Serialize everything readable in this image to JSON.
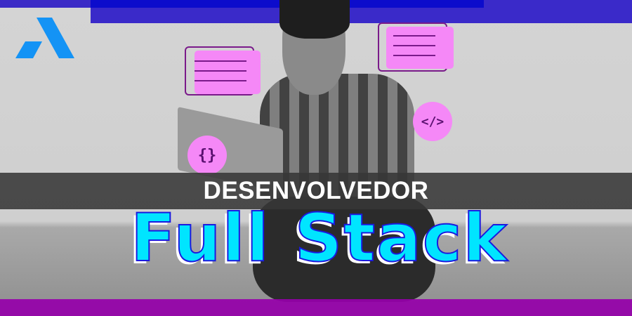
{
  "banner": {
    "subtitle": "DESENVOLVEDOR",
    "title": "Full Stack"
  },
  "decorations": {
    "code_tag_symbol": "</>",
    "braces_symbol": "{}"
  },
  "colors": {
    "logo": "#1493f5",
    "top_bar": "#3a2ac9",
    "title_fill": "#00e5ff",
    "title_stroke": "#1a1adf",
    "accent_pink": "#f588f7",
    "bottom_bar": "#9600aa"
  }
}
